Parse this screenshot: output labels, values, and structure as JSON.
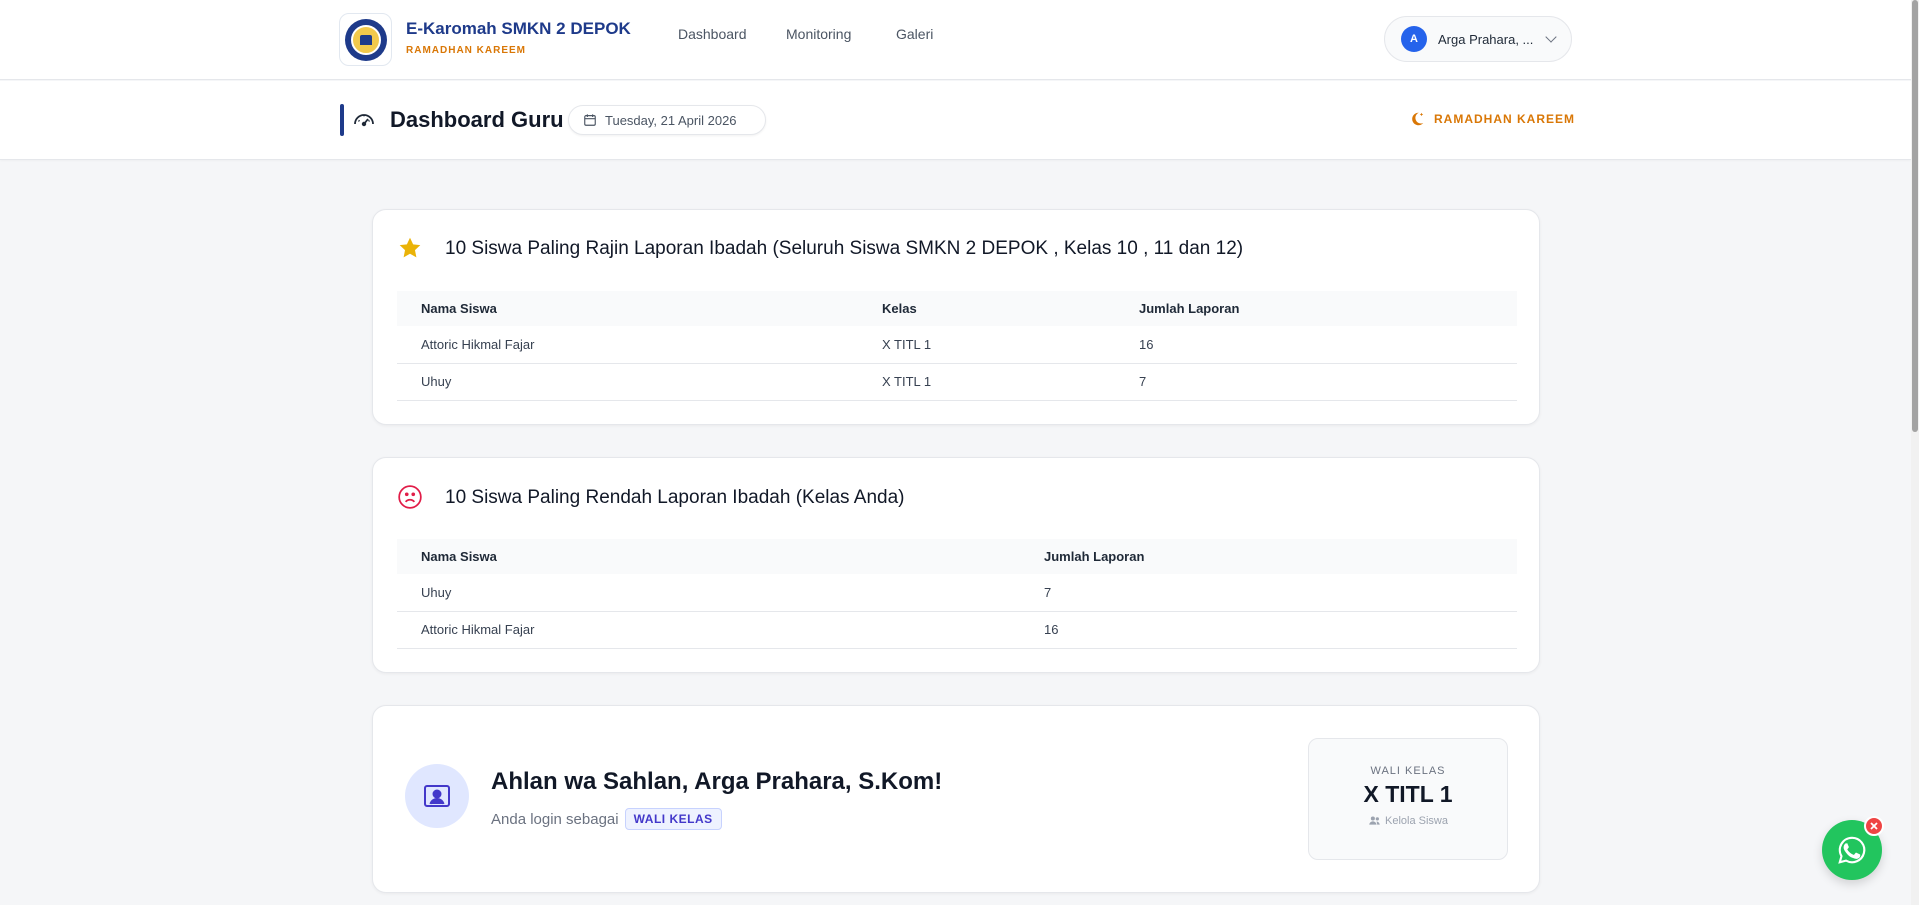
{
  "brand": {
    "title": "E-Karomah SMKN 2 DEPOK",
    "subtitle": "RAMADHAN KAREEM"
  },
  "nav": {
    "links": [
      "Dashboard",
      "Monitoring",
      "Galeri"
    ]
  },
  "user": {
    "initial": "A",
    "name": "Arga Prahara, ..."
  },
  "subheader": {
    "title": "Dashboard Guru",
    "date": "Tuesday, 21 April 2026",
    "ramadhan": "RAMADHAN KAREEM"
  },
  "top_students": {
    "title": "10 Siswa Paling Rajin Laporan Ibadah (Seluruh Siswa SMKN 2 DEPOK , Kelas 10 , 11 dan 12)",
    "headers": [
      "Nama Siswa",
      "Kelas",
      "Jumlah Laporan"
    ],
    "rows": [
      [
        "Attoric Hikmal Fajar",
        "X TITL 1",
        "16"
      ],
      [
        "Uhuy",
        "X TITL 1",
        "7"
      ]
    ]
  },
  "low_students": {
    "title": "10 Siswa Paling Rendah Laporan Ibadah (Kelas Anda)",
    "headers": [
      "Nama Siswa",
      "Jumlah Laporan"
    ],
    "rows": [
      [
        "Uhuy",
        "7"
      ],
      [
        "Attoric Hikmal Fajar",
        "16"
      ]
    ]
  },
  "welcome": {
    "title": "Ahlan wa Sahlan, Arga Prahara, S.Kom!",
    "login_as": "Anda login sebagai",
    "role": "WALI KELAS",
    "box_label": "WALI KELAS",
    "box_class": "X TITL 1",
    "box_link": "Kelola Siswa"
  },
  "colors": {
    "primary": "#1e3a8a",
    "accent": "#d97706",
    "whatsapp": "#22c55e"
  }
}
